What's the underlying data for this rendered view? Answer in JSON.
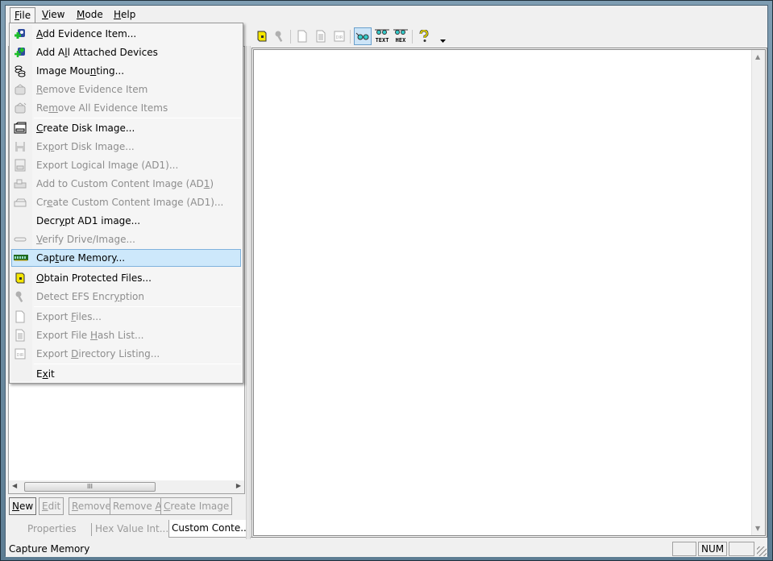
{
  "menubar": {
    "items": [
      {
        "label": "File",
        "accel": "F",
        "rest": "ile",
        "open": true
      },
      {
        "label": "View",
        "accel": "V",
        "rest": "iew"
      },
      {
        "label": "Mode",
        "accel": "M",
        "rest": "ode"
      },
      {
        "label": "Help",
        "accel": "H",
        "rest": "elp"
      }
    ]
  },
  "file_menu": {
    "items": [
      {
        "pre": "",
        "accel": "A",
        "post": "dd Evidence Item...",
        "label": "Add Evidence Item...",
        "icon": "add-evidence-icon",
        "enabled": true
      },
      {
        "pre": "Add A",
        "accel": "l",
        "post": "l Attached Devices",
        "label": "Add All Attached Devices",
        "icon": "add-all-devices-icon",
        "enabled": true
      },
      {
        "pre": "Image Mou",
        "accel": "n",
        "post": "ting...",
        "label": "Image Mounting...",
        "icon": "image-mounting-icon",
        "enabled": true
      },
      {
        "pre": "",
        "accel": "R",
        "post": "emove Evidence Item",
        "label": "Remove Evidence Item",
        "icon": "remove-evidence-icon",
        "enabled": false
      },
      {
        "pre": "Re",
        "accel": "m",
        "post": "ove All Evidence Items",
        "label": "Remove All Evidence Items",
        "icon": "remove-all-evidence-icon",
        "enabled": false
      },
      {
        "pre": "",
        "accel": "C",
        "post": "reate Disk Image...",
        "label": "Create Disk Image...",
        "icon": "create-disk-image-icon",
        "enabled": true
      },
      {
        "pre": "Ex",
        "accel": "p",
        "post": "ort Disk Image...",
        "label": "Export Disk Image...",
        "icon": "export-disk-image-icon",
        "enabled": false
      },
      {
        "pre": "Export Logical Ima",
        "accel": "g",
        "post": "e (AD1)...",
        "label": "Export Logical Image (AD1)...",
        "icon": "export-logical-image-icon",
        "enabled": false
      },
      {
        "pre": "Add to Custom Content Image (AD",
        "accel": "1",
        "post": ")",
        "label": "Add to Custom Content Image (AD1)",
        "icon": "add-custom-content-icon",
        "enabled": false
      },
      {
        "pre": "Cr",
        "accel": "e",
        "post": "ate Custom Content Image (AD1)...",
        "label": "Create Custom Content Image (AD1)...",
        "icon": "create-custom-content-icon",
        "enabled": false
      },
      {
        "pre": "Decr",
        "accel": "y",
        "post": "pt AD1 image...",
        "label": "Decrypt AD1 image...",
        "icon": "",
        "enabled": true
      },
      {
        "pre": "",
        "accel": "V",
        "post": "erify Drive/Image...",
        "label": "Verify Drive/Image...",
        "icon": "verify-drive-icon",
        "enabled": false
      },
      {
        "pre": "Cap",
        "accel": "t",
        "post": "ure Memory...",
        "label": "Capture Memory...",
        "icon": "memory-chip-icon",
        "enabled": true,
        "highlighted": true
      },
      {
        "pre": "",
        "accel": "O",
        "post": "btain Protected Files...",
        "label": "Obtain Protected Files...",
        "icon": "protected-files-icon",
        "enabled": true
      },
      {
        "pre": "Detect EFS Encr",
        "accel": "y",
        "post": "ption",
        "label": "Detect EFS Encryption",
        "icon": "key-icon",
        "enabled": false
      },
      {
        "pre": "Export ",
        "accel": "F",
        "post": "iles...",
        "label": "Export Files...",
        "icon": "file-icon",
        "enabled": false
      },
      {
        "pre": "Export File ",
        "accel": "H",
        "post": "ash List...",
        "label": "Export File Hash List...",
        "icon": "hash-list-icon",
        "enabled": false
      },
      {
        "pre": "Export ",
        "accel": "D",
        "post": "irectory Listing...",
        "label": "Export Directory Listing...",
        "icon": "directory-listing-icon",
        "enabled": false
      },
      {
        "pre": "E",
        "accel": "x",
        "post": "it",
        "label": "Exit",
        "icon": "",
        "enabled": true
      }
    ]
  },
  "toolbar": {
    "buttons": [
      {
        "name": "obtain-protected-files",
        "icon": "protected-files-icon",
        "enabled": true
      },
      {
        "name": "detect-efs",
        "icon": "key-icon",
        "enabled": false
      },
      {
        "name": "export-files",
        "icon": "file-icon",
        "enabled": false
      },
      {
        "name": "export-hash-list",
        "icon": "hash-list-icon",
        "enabled": false
      },
      {
        "name": "export-directory-listing",
        "icon": "directory-listing-icon",
        "enabled": false
      },
      {
        "name": "auto-view",
        "icon": "glasses-icon",
        "enabled": true,
        "active": true
      },
      {
        "name": "text-view",
        "icon": "glasses-text-icon",
        "label": "TEXT",
        "enabled": true
      },
      {
        "name": "hex-view",
        "icon": "glasses-hex-icon",
        "label": "HEX",
        "enabled": true
      },
      {
        "name": "help",
        "icon": "help-icon",
        "enabled": true
      },
      {
        "name": "toolbar-overflow",
        "icon": "dropdown-arrow-icon",
        "enabled": true
      }
    ],
    "dir_label": "DIR"
  },
  "left_panel": {
    "scroll_thumb_glyph": "III",
    "buttons": [
      {
        "pre": "",
        "accel": "N",
        "post": "ew",
        "label": "New",
        "enabled": true
      },
      {
        "pre": "",
        "accel": "E",
        "post": "dit",
        "label": "Edit",
        "enabled": false
      },
      {
        "pre": "",
        "accel": "R",
        "post": "emove",
        "label": "Remove",
        "enabled": false
      },
      {
        "pre": "Remove ",
        "accel": "A",
        "post": "ll",
        "label": "Remove All",
        "enabled": false
      },
      {
        "pre": "",
        "accel": "C",
        "post": "reate Image",
        "label": "Create Image",
        "enabled": false
      }
    ],
    "tabs": [
      {
        "label": "Properties",
        "active": false
      },
      {
        "label": "Hex Value Int...",
        "active": false
      },
      {
        "label": "Custom Conte...",
        "active": true
      }
    ]
  },
  "statusbar": {
    "text": "Capture Memory",
    "panels": [
      "",
      "NUM",
      ""
    ]
  }
}
